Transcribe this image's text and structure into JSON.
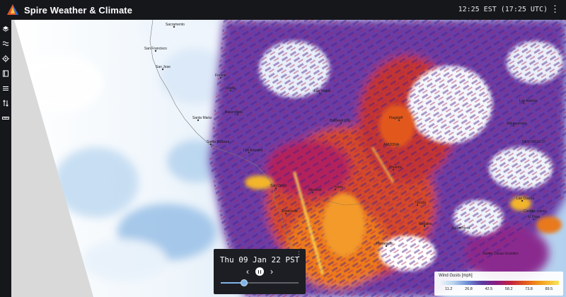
{
  "app": {
    "title": "Spire Weather & Climate",
    "clock": "12:25 EST (17:25 UTC)",
    "menu_icon": "kebab-icon"
  },
  "sidebar": {
    "items": [
      {
        "icon": "layers-icon"
      },
      {
        "icon": "waves-icon"
      },
      {
        "icon": "crosshair-icon"
      },
      {
        "icon": "book-icon"
      },
      {
        "icon": "wind-lines-icon"
      },
      {
        "icon": "swap-vertical-icon"
      },
      {
        "icon": "ruler-icon"
      }
    ]
  },
  "map": {
    "cities": {
      "sacramento": "Sacramento",
      "san_francisco": "San Francisco",
      "san_jose": "San Jose",
      "fresno": "Fresno",
      "visalia": "Visalia",
      "bakersfield": "Bakersfield",
      "santa_maria": "Santa Maria",
      "santa_barbara": "Santa Barbara",
      "los_angeles": "Los Angeles",
      "san_diego": "San Diego",
      "ensenada": "Ensenada",
      "mexicali": "Mexicali",
      "yuma": "Yuma",
      "las_vegas": "Las Vegas",
      "bullhead_city": "Bullhead City",
      "flagstaff": "Flagstaff",
      "arizona": "ARIZONA",
      "phoenix": "Phoenix",
      "tucson": "Tucson",
      "nogales": "Nogales",
      "hermosillo": "Hermosillo",
      "los_alamos": "Los Alamos",
      "albuquerque": "Albuquerque",
      "new_mexico": "NEW MEXICO",
      "las_cruces": "Las Cruces",
      "ciudad_juarez": "Ciudad Juárez",
      "agua_prieta": "Agua Prieta",
      "nuevo_casas_grandes": "Nuevo Casas Grandes",
      "el_paso": "El Paso"
    }
  },
  "timeline": {
    "date": "Thu 09 Jan 22 PST",
    "prev_icon": "chevron-left-icon",
    "pause_icon": "pause-icon",
    "next_icon": "chevron-right-icon",
    "menu_icon": "kebab-icon",
    "position": 0.3
  },
  "legend": {
    "title": "Wind Gusts [mph]",
    "ticks": [
      "11.2",
      "26.8",
      "42.5",
      "58.2",
      "73.8",
      "89.5"
    ]
  }
}
